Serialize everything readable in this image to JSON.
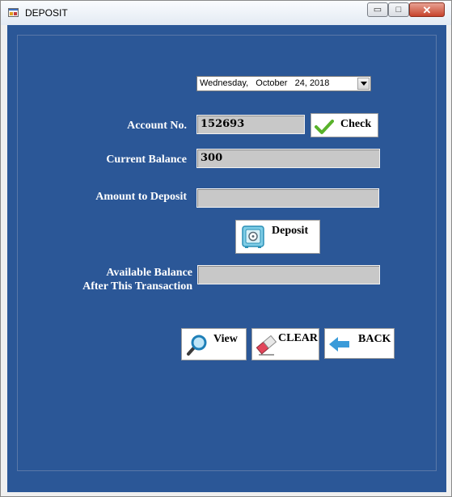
{
  "window": {
    "title": "DEPOSIT",
    "minimize_glyph": "▭",
    "maximize_glyph": "□",
    "close_glyph": "✕"
  },
  "form": {
    "date": "Wednesday,   October   24, 2018",
    "account_label": "Account No.",
    "account_value": "152693",
    "check_label": "Check",
    "balance_label": "Current Balance",
    "balance_value": "300",
    "amount_label": "Amount to Deposit",
    "amount_value": "",
    "deposit_label": "Deposit",
    "available_label_line1": "Available Balance",
    "available_label_line2": "After This Transaction",
    "available_value": ""
  },
  "buttons": {
    "view_label": "View",
    "clear_label": "CLEAR",
    "back_label": "BACK"
  },
  "icons": [
    "app-icon",
    "check-icon",
    "safe-icon",
    "magnifier-icon",
    "eraser-icon",
    "back-arrow-icon",
    "dropdown-arrow-icon"
  ],
  "colors": {
    "client_bg": "#2b5797",
    "field_bg": "#c8c8c8",
    "close_red": "#c7432c",
    "accent_blue": "#3a9bd9",
    "check_green": "#58b22a"
  }
}
